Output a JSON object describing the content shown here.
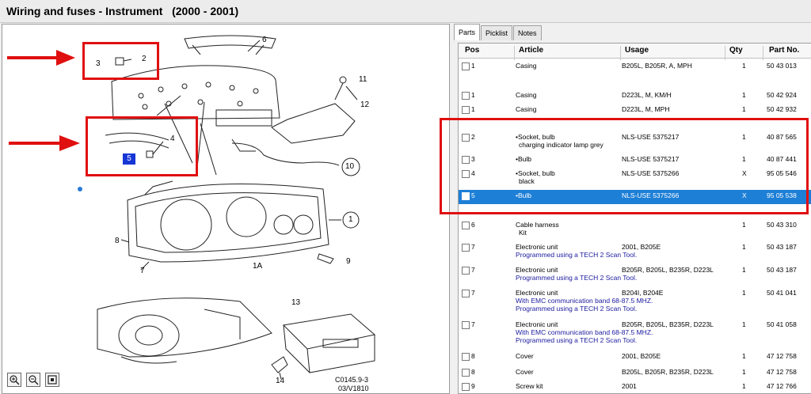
{
  "window": {
    "title": "Wiring and fuses - Instrument   (2000 - 2001)"
  },
  "diagram": {
    "callouts": [
      "3",
      "2",
      "6",
      "11",
      "12",
      "4",
      "10",
      "1",
      "8",
      "9",
      "7",
      "1A",
      "13",
      "14"
    ],
    "selected_callout": "5",
    "figure_code_1": "C0145.9-3",
    "figure_code_2": "03/V1810"
  },
  "zoom_controls": [
    "zoom-in-icon",
    "zoom-out-icon",
    "fit-icon"
  ],
  "tabs": [
    {
      "label": "Parts",
      "active": true
    },
    {
      "label": "Picklist",
      "active": false
    },
    {
      "label": "Notes",
      "active": false
    }
  ],
  "table": {
    "columns": [
      "Pos",
      "Article",
      "Usage",
      "Qty",
      "Part No."
    ],
    "rows": [
      {
        "pos": "1",
        "article": "Casing",
        "usage": "B205L, B205R, A, MPH",
        "qty": "1",
        "part": "50 43 013",
        "note": ""
      },
      {
        "pos": "1",
        "article": "Casing",
        "usage": "D223L, M, KM/H",
        "qty": "1",
        "part": "50 42 924",
        "note": ""
      },
      {
        "pos": "1",
        "article": "Casing",
        "usage": "D223L, M, MPH",
        "qty": "1",
        "part": "50 42 932",
        "note": ""
      },
      {
        "pos": "2",
        "article": "•Socket, bulb",
        "article2": "charging indicator lamp  grey",
        "usage": "NLS-USE 5375217",
        "qty": "1",
        "part": "40 87 565",
        "note": ""
      },
      {
        "pos": "3",
        "article": "•Bulb",
        "usage": "NLS-USE 5375217",
        "qty": "1",
        "part": "40 87 441",
        "note": ""
      },
      {
        "pos": "4",
        "article": "•Socket, bulb",
        "article2": "black",
        "usage": "NLS-USE 5375266",
        "qty": "X",
        "part": "95 05 546",
        "note": ""
      },
      {
        "pos": "5",
        "article": "•Bulb",
        "usage": "NLS-USE 5375266",
        "qty": "X",
        "part": "95 05 538",
        "note": "",
        "selected": true
      },
      {
        "pos": "6",
        "article": "Cable harness",
        "article2": "Kit",
        "usage": "",
        "qty": "1",
        "part": "50 43 310",
        "note": ""
      },
      {
        "pos": "7",
        "article": "Electronic unit",
        "usage": "2001, B205E",
        "qty": "1",
        "part": "50 43 187",
        "note": "Programmed using a TECH 2 Scan Tool."
      },
      {
        "pos": "7",
        "article": "Electronic unit",
        "usage": "B205R, B205L, B235R, D223L",
        "qty": "1",
        "part": "50 43 187",
        "note": "Programmed using a TECH 2 Scan Tool."
      },
      {
        "pos": "7",
        "article": "Electronic unit",
        "usage": "B204I, B204E",
        "qty": "1",
        "part": "50 41 041",
        "note": "With EMC communication band 68-87.5 MHZ.",
        "note2": "Programmed using a TECH 2 Scan Tool."
      },
      {
        "pos": "7",
        "article": "Electronic unit",
        "usage": "B205R, B205L, B235R, D223L",
        "qty": "1",
        "part": "50 41 058",
        "note": "With EMC communication band 68-87.5 MHZ.",
        "note2": "Programmed using a TECH 2 Scan Tool."
      },
      {
        "pos": "8",
        "article": "Cover",
        "usage": "2001, B205E",
        "qty": "1",
        "part": "47 12 758",
        "note": ""
      },
      {
        "pos": "8",
        "article": "Cover",
        "usage": "B205L, B205R, B235R, D223L",
        "qty": "1",
        "part": "47 12 758",
        "note": ""
      },
      {
        "pos": "9",
        "article": "Screw kit",
        "usage": "2001",
        "qty": "1",
        "part": "47 12 766",
        "note": ""
      }
    ]
  },
  "colors": {
    "highlight": "#e01010",
    "selection": "#1e7fd6",
    "callout_selected": "#1636d6",
    "note_text": "#1a1aa0"
  }
}
